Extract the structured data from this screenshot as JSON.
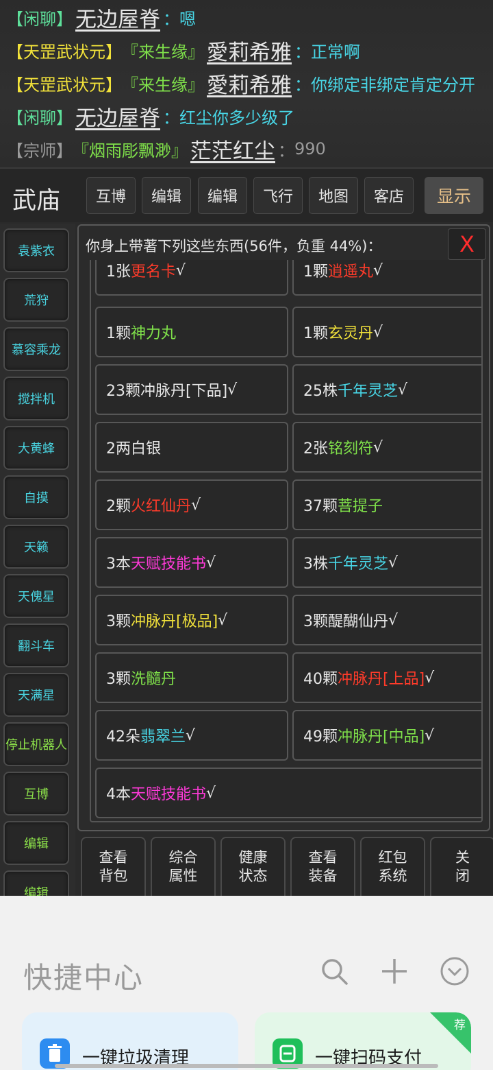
{
  "chat": [
    {
      "channel": "【闲聊】",
      "name": "无边屋脊",
      "sep": "：",
      "text": "嗯"
    },
    {
      "channel": "【天罡武状元】",
      "tag": "『来生缘』",
      "name": "愛莉希雅",
      "sep": "：",
      "text": "正常啊"
    },
    {
      "channel": "【天罡武状元】",
      "tag": "『来生缘』",
      "name": "愛莉希雅",
      "sep": "：",
      "text": "你绑定非绑定肯定分开"
    },
    {
      "channel": "【闲聊】",
      "name": "无边屋脊",
      "sep": "：",
      "text": "红尘你多少级了"
    },
    {
      "channel": "【宗师】",
      "tag": "『烟雨彫飘渺』",
      "name": "茫茫红尘",
      "sep": "：",
      "text": "990"
    }
  ],
  "topbar": {
    "place": "武庙",
    "buttons": [
      "互博",
      "编辑",
      "编辑",
      "飞行",
      "地图",
      "客店"
    ],
    "show_button": "显示"
  },
  "sidebar": [
    "袁紫衣",
    "荒狩",
    "慕容乘龙",
    "搅拌机",
    "大黄蜂",
    "自摸",
    "天籁",
    "天傀星",
    "翻斗车",
    "天满星",
    "停止机器人",
    "互博",
    "编辑",
    "编辑"
  ],
  "inventory": {
    "title": "你身上带著下列这些东西(56件，负重 44%)：",
    "close": "X",
    "items": [
      {
        "qty": "1张",
        "name": "更名卡",
        "suffix": "√"
      },
      {
        "qty": "1颗",
        "name": "逍遥丸",
        "suffix": "√"
      },
      {
        "qty": "1颗",
        "name": "神力丸",
        "suffix": ""
      },
      {
        "qty": "1颗",
        "name": "玄灵丹",
        "suffix": "√"
      },
      {
        "qty": "23颗冲脉丹[下品]",
        "name": "",
        "suffix": "√"
      },
      {
        "qty": "25株",
        "name": "千年灵芝",
        "suffix": "√"
      },
      {
        "qty": "2两白银",
        "name": "",
        "suffix": ""
      },
      {
        "qty": "2张",
        "name": "铭刻符",
        "suffix": "√"
      },
      {
        "qty": "2颗",
        "name": "火红仙丹",
        "suffix": "√"
      },
      {
        "qty": "37颗",
        "name": "菩提子",
        "suffix": ""
      },
      {
        "qty": "3本",
        "name": "天赋技能书",
        "suffix": "√"
      },
      {
        "qty": "3株",
        "name": "千年灵芝",
        "suffix": "√"
      },
      {
        "qty": "3颗",
        "name": "冲脉丹[极品]",
        "suffix": "√"
      },
      {
        "qty": "3颗醍醐仙丹",
        "name": "",
        "suffix": "√"
      },
      {
        "qty": "3颗",
        "name": "洗髓丹",
        "suffix": ""
      },
      {
        "qty": "40颗",
        "name": "冲脉丹[上品]",
        "suffix": "√"
      },
      {
        "qty": "42朵",
        "name": "翡翠兰",
        "suffix": "√"
      },
      {
        "qty": "49颗",
        "name": "冲脉丹[中品]",
        "suffix": "√"
      },
      {
        "qty": "4本",
        "name": "天赋技能书",
        "suffix": "√"
      }
    ]
  },
  "actions": [
    {
      "l1": "查看",
      "l2": "背包"
    },
    {
      "l1": "综合",
      "l2": "属性"
    },
    {
      "l1": "健康",
      "l2": "状态"
    },
    {
      "l1": "查看",
      "l2": "装备"
    },
    {
      "l1": "红包",
      "l2": "系统"
    },
    {
      "l1": "关",
      "l2": "闭"
    }
  ],
  "quick_center": {
    "title": "快捷中心",
    "cards": [
      {
        "label": "一键垃圾清理",
        "icon": "trash-icon",
        "color": "#2d8cf0"
      },
      {
        "label": "一键扫码支付",
        "icon": "scan-pay-icon",
        "color": "#1fbf5a",
        "badge": "荐"
      }
    ]
  }
}
